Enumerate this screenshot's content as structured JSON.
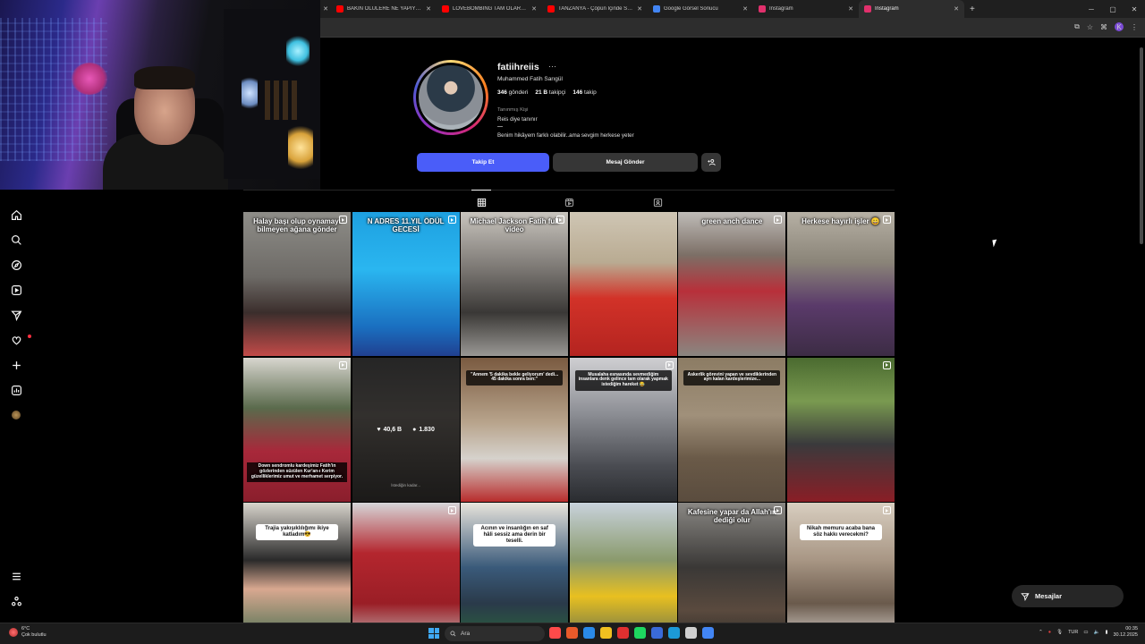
{
  "browser": {
    "tabs": [
      {
        "label": "BAKIN ÖLÜLERE NE YAPIYORL...",
        "favicon_color": "#ff0000",
        "active": false
      },
      {
        "label": "LOVEBOMBING TAM OLARAK...",
        "favicon_color": "#ff0000",
        "active": false
      },
      {
        "label": "TANZANYA - Çöpün İçinde SAT...",
        "favicon_color": "#ff0000",
        "active": false
      },
      {
        "label": "Google Görsel Sonucu",
        "favicon_color": "#4285f4",
        "active": false
      },
      {
        "label": "Instagram",
        "favicon_color": "#e1306c",
        "active": false
      },
      {
        "label": "Instagram",
        "favicon_color": "#e1306c",
        "active": true
      }
    ],
    "new_tab": "+",
    "window_controls": [
      "─",
      "▢",
      "✕"
    ],
    "profile_initial": "K"
  },
  "rail": {
    "items": [
      {
        "name": "home",
        "label": "Ana sayfa"
      },
      {
        "name": "search",
        "label": "Ara"
      },
      {
        "name": "explore",
        "label": "Keşfet"
      },
      {
        "name": "reels",
        "label": "Reels"
      },
      {
        "name": "messages",
        "label": "Mesajlar"
      },
      {
        "name": "notifications",
        "label": "Bildirimler"
      },
      {
        "name": "create",
        "label": "Oluştur"
      },
      {
        "name": "dashboard",
        "label": "Panel"
      },
      {
        "name": "profile",
        "label": "Profil"
      }
    ],
    "bottom": [
      {
        "name": "more",
        "label": "Daha fazla"
      },
      {
        "name": "threads",
        "label": "Threads"
      }
    ]
  },
  "profile": {
    "username": "fatiihreiis",
    "more": "···",
    "full_name": "Muhammed Fatih Sarıgül",
    "stats": {
      "posts_count": "346",
      "posts_label": "gönderi",
      "followers_count": "21 B",
      "followers_label": "takipçi",
      "following_count": "146",
      "following_label": "takip"
    },
    "category": "Tanınmış Kişi",
    "bio_line1": "Reis diye tanınır",
    "bio_line2": "Benim hikâyem farklı olabilir..ama sevgim herkese yeter",
    "follow_button": "Takip Et",
    "message_button": "Mesaj Gönder",
    "suggest_icon": "+👤"
  },
  "tabs": [
    {
      "name": "posts",
      "icon": "grid-icon",
      "active": true
    },
    {
      "name": "reels",
      "icon": "reels-icon",
      "active": false
    },
    {
      "name": "tagged",
      "icon": "tagged-icon",
      "active": false
    }
  ],
  "posts": [
    {
      "caption": "Halay başı olup oynamayı bilmeyen ağana gönder",
      "style": "top",
      "bg": "linear-gradient(180deg,#8e8d88 0%,#6d6a66 45%,#3b2e2c 70%,#c24a48 100%)",
      "reel": true
    },
    {
      "caption": "N ADRES 11.YIL ÖDÜL GECESİ",
      "style": "top",
      "bg": "linear-gradient(180deg,#1ea0e0 0%,#2ab6f0 40%,#1a6fc0 80%,#204090 100%)",
      "reel": true
    },
    {
      "caption": "Michael Jackson Fatih full video",
      "style": "top",
      "bg": "linear-gradient(180deg,#c8c4bd 0%,#7a7672 40%,#3a3836 70%,#9a9894 100%)",
      "reel": true
    },
    {
      "caption": "",
      "style": "none",
      "bg": "linear-gradient(180deg,#cfc6b4 0%,#b9ab92 35%,#d23228 60%,#b42420 100%)",
      "reel": false
    },
    {
      "caption": "green anch dance",
      "style": "top",
      "bg": "linear-gradient(180deg,#bfbcb8 0%,#7c6f66 30%,#b8303a 55%,#8a8680 100%)",
      "reel": true
    },
    {
      "caption": "Herkese hayırlı işler 😀",
      "style": "top",
      "bg": "linear-gradient(180deg,#b6b0a4 0%,#8a8478 35%,#5a3a6a 65%,#3c2c44 100%)",
      "reel": true
    },
    {
      "caption": "Down sendromlu kardeşimiz Fatih'in gözlerinden süzülen Kur'an-ı Kerim güzelliklerimiz umut ve merhamet serpiyor.",
      "style": "bottom",
      "bg": "linear-gradient(180deg,#d8d6cf 0%,#5a6a4c 35%,#a8283a 65%,#8a1e2c 100%)",
      "reel": true
    },
    {
      "caption": "",
      "style": "overlay",
      "bg": "linear-gradient(180deg,#3a3a3a 0%,#4e4a46 40%,#2a2826 100%)",
      "reel": false,
      "likes": "40,6 B",
      "comments": "1.830",
      "footnote": "İstediğin kadar..."
    },
    {
      "caption": "\"Annem '5 dakika bekle geliyorum' dedi... 45 dakika sonra ben:\"",
      "style": "dark",
      "bg": "linear-gradient(180deg,#7a5a40 0%,#b8a48c 45%,#d6d2cc 70%,#b82c2c 100%)",
      "reel": false
    },
    {
      "caption": "Musalaha esnasında sevmediğim insanlara denk gelince tam olarak yapmak istediğim hareket 😂",
      "style": "dark",
      "bg": "linear-gradient(180deg,#cfcfd2 0%,#8a8c92 40%,#4a4c52 75%,#2a2c30 100%)",
      "reel": true
    },
    {
      "caption": "Askerlik görevini yapan ve sevdiklerinden ayrı kalan kardeşlerimize...",
      "style": "dark",
      "bg": "linear-gradient(180deg,#8c7c64 0%,#a0907a 40%,#6a5a48 70%,#5a4c3e 100%)",
      "reel": false
    },
    {
      "caption": "",
      "style": "none",
      "bg": "linear-gradient(180deg,#4a6a30 0%,#7a9a50 30%,#3a3a3c 60%,#8a1e26 100%)",
      "reel": true
    },
    {
      "caption": "Trajia yakışıklılığımı ikiye katladım😎",
      "style": "boxed",
      "bg": "linear-gradient(180deg,#d8d4cc 0%,#2a2a2a 40%,#d8a890 60%,#3a6a4a 100%)",
      "reel": false
    },
    {
      "caption": "",
      "style": "none",
      "bg": "linear-gradient(180deg,#d6d6d8 0%,#b4262e 35%,#9a1e26 70%,#c8c6c4 100%)",
      "reel": true
    },
    {
      "caption": "Acının ve insanlığın en saf hâli sessiz ama derin bir teselli.",
      "style": "boxed",
      "bg": "linear-gradient(180deg,#e8e4dc 0%,#3a5a7a 45%,#2a3a4a 70%,#2a6a3a 100%)",
      "reel": false
    },
    {
      "caption": "",
      "style": "none",
      "bg": "linear-gradient(180deg,#c8d2dc 0%,#8a9a6c 40%,#e8c020 65%,#5a6a54 100%)",
      "reel": false
    },
    {
      "caption": "Kafesine yapar da Allah'ın dediği olur",
      "style": "top",
      "bg": "linear-gradient(180deg,#8a8884 0%,#3a3836 45%,#5a4a3e 75%,#2a2826 100%)",
      "reel": true
    },
    {
      "caption": "Nikah memuru acaba bana söz hakkı verecekmi?",
      "style": "boxed",
      "bg": "linear-gradient(180deg,#d8cec0 0%,#a89684 40%,#6a5a4c 70%,#e8e4e0 100%)",
      "reel": true
    }
  ],
  "messages_pill": "Mesajlar",
  "taskbar": {
    "weather_temp": "6°C",
    "weather_desc": "Çok bulutlu",
    "search_placeholder": "Ara",
    "language": "TUR",
    "time": "00:35",
    "date": "30.12.2025",
    "app_colors": [
      "#ff4a4a",
      "#e85a2a",
      "#2a8ae8",
      "#f0c020",
      "#e03030",
      "#1ed760",
      "#3a6ad8",
      "#1c9ad8",
      "#d0d0d0",
      "#4285f4"
    ]
  }
}
